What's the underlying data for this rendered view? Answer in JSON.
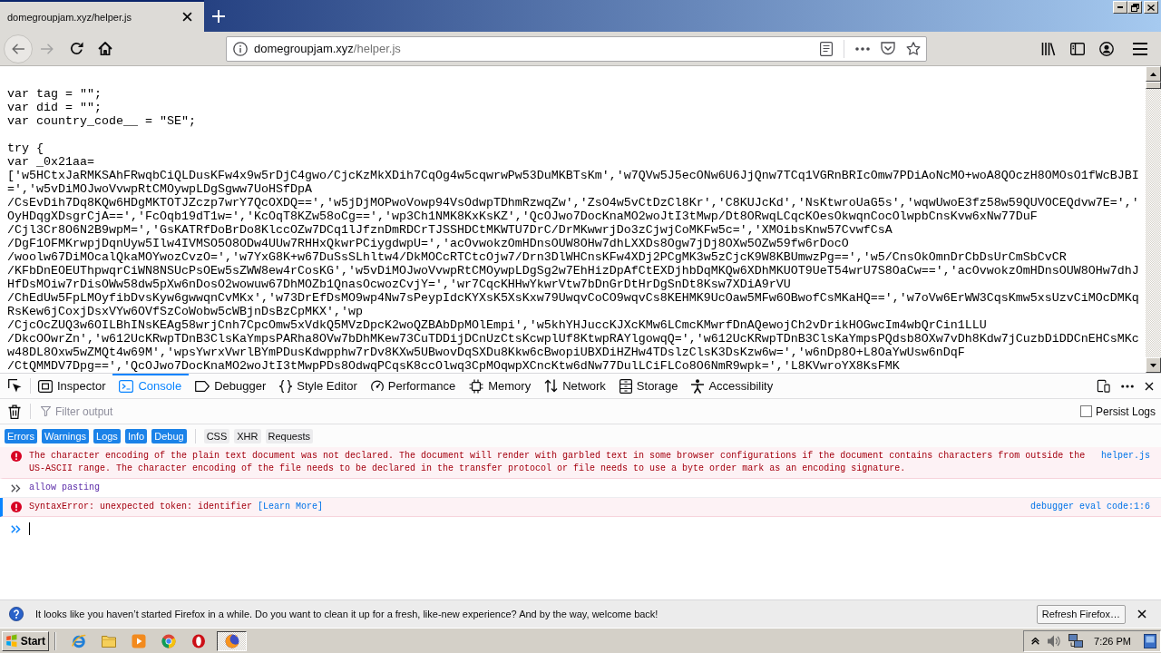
{
  "browser": {
    "tabs": [
      {
        "title": "domegroupjam.xyz/helper.js",
        "selected": true
      }
    ],
    "back": {
      "disabled": false
    },
    "forward": {
      "disabled": true
    },
    "url": {
      "host": "domegroupjam.xyz",
      "path": "/helper.js"
    }
  },
  "page": {
    "blocks": [
      [
        "var tag = \"\";",
        "var did = \"\";",
        "var country_code__ = \"SE\";"
      ],
      [
        "try {",
        "var _0x21aa=",
        "['w5HCtxJaRMKSAhFRwqbCiQLDusKFw4x9w5rDjC4gwo/CjcKzMkXDih7CqOg4w5cqwrwPw53DuMKBTsKm','w7QVw5J5ecONw6U6JjQnw7TCq1VGRnBRIcOmw7PDiAoNcMO+woA8QOczH8OMOsO1fWcBJBI",
        "=','w5vDiMOJwoVvwpRtCMOywpLDgSgww7UoHSfDpA",
        "/CsEvDih7Dq8KQw6HDgMKTOTJZczp7wrY7QcOXDQ==','w5jDjMOPwoVowp94VsOdwpTDhmRzwqZw','ZsO4w5vCtDzCl8Kr','C8KUJcKd','NsKtwroUaG5s','wqwUwoE3fz58w59QUVOCEQdvw7E=','",
        "OyHDqgXDsgrCjA==','FcOqb19dT1w=','KcOqT8KZw58oCg==','wp3Ch1NMK8KxKsKZ','QcOJwo7DocKnaMO2woJtI3tMwp/Dt8ORwqLCqcKOesOkwqnCocOlwpbCnsKvw6xNw77DuF",
        "/Cjl3Cr8O6N2B9wpM=','GsKATRfDoBrDo8KlccOZw7DCq1lJfznDmRDCrTJSSHDCtMKWTU7DrC/DrMKwwrjDo3zCjwjCoMKFw5c=','XMOibsKnw57CvwfCsA",
        "/DgF1OFMKrwpjDqnUyw5Ilw4IVMSO5O8ODw4UUw7RHHxQkwrPCiygdwpU=','acOvwokzOmHDnsOUW8OHw7dhLXXDs8Ogw7jDj8OXw5OZw59fw6rDocO",
        "/woolw67DiMOcalQkaMOYwozCvzO=','w7YxG8K+w67DuSsSLhltw4/DkMOCcRTCtcOjw7/Drn3DlWHCnsKFw4XDj2PCgMK3w5zCjcK9W8KBUmwzPg==','w5/CnsOkOmnDrCbDsUrCmSbCvCR",
        "/KFbDnEOEUThpwqrCiWN8NSUcPsOEw5sZWW8ew4rCosKG','w5vDiMOJwoVvwpRtCMOywpLDgSg2w7EhHizDpAfCtEXDjhbDqMKQw6XDhMKUOT9UeT54wrU7S8OaCw==','acOvwokzOmHDnsOUW8OHw7dhJ",
        "HfDsMOiw7rDisOWw58dw5pXw6nDosO2wowuw67DhMOZb1QnasOcwozCvjY=','wr7CqcKHHwYkwrVtw7bDnGrDtHrDgSnDt8Ksw7XDiA9rVU",
        "/ChEdUw5FpLMOyfibDvsKyw6gwwqnCvMKx','w73DrEfDsMO9wp4Nw7sPeypIdcKYXsK5XsKxw79UwqvCoCO9wqvCs8KEHMK9UcOaw5MFw6OBwofCsMKaHQ==','w7oVw6ErWW3CqsKmw5xsUzvCiMOcDMKq",
        "RsKew6jCoxjDsxVYw6OVfSzCoWobw5cWBjnDsBzCpMKX','wp",
        "/CjcOcZUQ3w6OILBhINsKEAg58wrjCnh7CpcOmw5xVdkQ5MVzDpcK2woQZBAbDpMOlEmpi','w5khYHJuccKJXcKMw6LCmcKMwrfDnAQewojCh2vDrikHOGwcIm4wbQrCin1LLU",
        "/DkcOOwrZn','w612UcKRwpTDnB3ClsKaYmpsPARha8OVw7bDhMKew73CuTDDijDCnUzCtsKcwplUf8KtwpRAYlgowqQ=','w612UcKRwpTDnB3ClsKaYmpsPQdsb8OXw7vDh8Kdw7jCuzbDiDDCnEHCsMKc",
        "w48DL8Oxw5wZMQt4w69M','wpsYwrxVwrlBYmPDusKdwpphw7rDv8KXw5UBwovDqSXDu8Kkw6cBwopiUBXDiHZHw4TDslzClsK3DsKzw6w=','w6nDp8O+L8OaYwUsw6nDqF",
        "/CtQMMDV7Dpg==','QcOJwo7DocKnaMO2woJtI3tMwpPDs8OdwqPCqsK8ccOlwq3CpMOqwpXCncKtw6dNw77DulLCiFLCo8O6NmR9wpk=','L8KVwroYX8KsFMK"
      ]
    ]
  },
  "devtools": {
    "tabs": [
      {
        "label": "Inspector",
        "kind": "inspector",
        "selected": false
      },
      {
        "label": "Console",
        "kind": "console",
        "selected": true
      },
      {
        "label": "Debugger",
        "kind": "debugger",
        "selected": false
      },
      {
        "label": "Style Editor",
        "kind": "style",
        "selected": false
      },
      {
        "label": "Performance",
        "kind": "performance",
        "selected": false
      },
      {
        "label": "Memory",
        "kind": "memory",
        "selected": false
      },
      {
        "label": "Network",
        "kind": "network",
        "selected": false
      },
      {
        "label": "Storage",
        "kind": "storage",
        "selected": false
      },
      {
        "label": "Accessibility",
        "kind": "accessibility",
        "selected": false
      }
    ],
    "filter": {
      "placeholder": "Filter output"
    },
    "persist_logs": {
      "label": "Persist Logs",
      "checked": false
    },
    "level_filters": [
      {
        "label": "Errors",
        "selected": true
      },
      {
        "label": "Warnings",
        "selected": true
      },
      {
        "label": "Logs",
        "selected": true
      },
      {
        "label": "Info",
        "selected": true
      },
      {
        "label": "Debug",
        "selected": true
      }
    ],
    "type_filters": [
      {
        "label": "CSS",
        "selected": false
      },
      {
        "label": "XHR",
        "selected": false
      },
      {
        "label": "Requests",
        "selected": false
      }
    ],
    "messages": [
      {
        "kind": "error",
        "text": "The character encoding of the plain text document was not declared. The document will render with garbled text in some browser configurations if the document contains characters from outside the US-ASCII range. The character encoding of the file needs to be declared in the transfer protocol or file needs to use a byte order mark as an encoding signature.",
        "source": "helper.js",
        "highlighted": false
      },
      {
        "kind": "input",
        "text": "allow pasting",
        "highlighted": false
      },
      {
        "kind": "error",
        "text": "SyntaxError: unexpected token: identifier",
        "link": "[Learn More]",
        "source": "debugger eval code:1:6",
        "highlighted": true
      }
    ],
    "prompt": {
      "focused": true
    }
  },
  "notification": {
    "text": "It looks like you haven’t started Firefox in a while. Do you want to clean it up for a fresh, like-new experience? And by the way, welcome back!",
    "button": "Refresh Firefox…"
  },
  "taskbar": {
    "start": "Start",
    "apps": [
      {
        "kind": "globe",
        "selected": false
      },
      {
        "kind": "folder",
        "selected": false
      },
      {
        "kind": "player",
        "selected": false
      },
      {
        "kind": "wheel",
        "selected": false
      },
      {
        "kind": "ring",
        "selected": false
      },
      {
        "kind": "fox",
        "selected": true
      }
    ],
    "clock": "7:26 PM"
  }
}
